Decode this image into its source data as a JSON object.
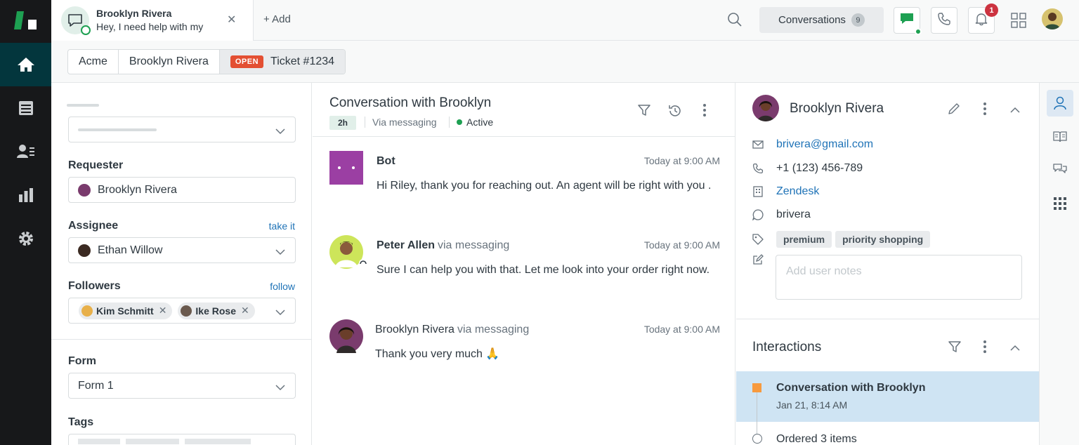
{
  "topbar": {
    "ticket_tab": {
      "name": "Brooklyn Rivera",
      "preview": "Hey, I need help with my"
    },
    "add_label": "+ Add",
    "conversations_label": "Conversations",
    "conversations_count": "9",
    "notifications_count": "1"
  },
  "breadcrumb": {
    "org": "Acme",
    "requester": "Brooklyn Rivera",
    "status": "OPEN",
    "ticket": "Ticket #1234"
  },
  "ticket_fields": {
    "requester_label": "Requester",
    "requester_value": "Brooklyn Rivera",
    "assignee_label": "Assignee",
    "assignee_link": "take it",
    "assignee_value": "Ethan Willow",
    "followers_label": "Followers",
    "followers_link": "follow",
    "followers": [
      "Kim Schmitt",
      "Ike Rose"
    ],
    "form_label": "Form",
    "form_value": "Form 1",
    "tags_label": "Tags"
  },
  "conversation": {
    "title": "Conversation with Brooklyn",
    "age": "2h",
    "channel": "Via messaging",
    "status": "Active",
    "messages": [
      {
        "author": "Bot",
        "via": "",
        "time": "Today at 9:00 AM",
        "text": "Hi Riley, thank you for reaching out. An agent will be right with you ."
      },
      {
        "author": "Peter Allen",
        "via": "via messaging",
        "time": "Today at 9:00 AM",
        "text": "Sure I can help you with that. Let me look into your order right now."
      },
      {
        "author": "Brooklyn Rivera",
        "via": "via messaging",
        "time": "Today at 9:00 AM",
        "text": "Thank you very much 🙏"
      }
    ]
  },
  "customer": {
    "name": "Brooklyn Rivera",
    "email": "brivera@gmail.com",
    "phone": "+1 (123) 456-789",
    "company": "Zendesk",
    "whatsapp": "brivera",
    "tags": [
      "premium",
      "priority shopping"
    ],
    "notes_placeholder": "Add user notes"
  },
  "interactions": {
    "title": "Interactions",
    "items": [
      {
        "title": "Conversation with Brooklyn",
        "date": "Jan 21, 8:14 AM"
      },
      {
        "title": "Ordered 3 items"
      }
    ]
  },
  "colors": {
    "nav_bg": "#17181a",
    "nav_active": "#03363d",
    "brand_green": "#1ea052",
    "open_badge": "#e34f32",
    "link_blue": "#1f73b7",
    "selected_bg": "#cfe4f3",
    "bot_purple": "#9b3fa3"
  },
  "icons": {
    "nav": [
      "home-icon",
      "views-icon",
      "customers-icon",
      "reports-icon",
      "admin-icon"
    ],
    "rail": [
      "user-profile-icon",
      "knowledge-icon",
      "context-chat-icon",
      "apps-grid-icon"
    ]
  }
}
